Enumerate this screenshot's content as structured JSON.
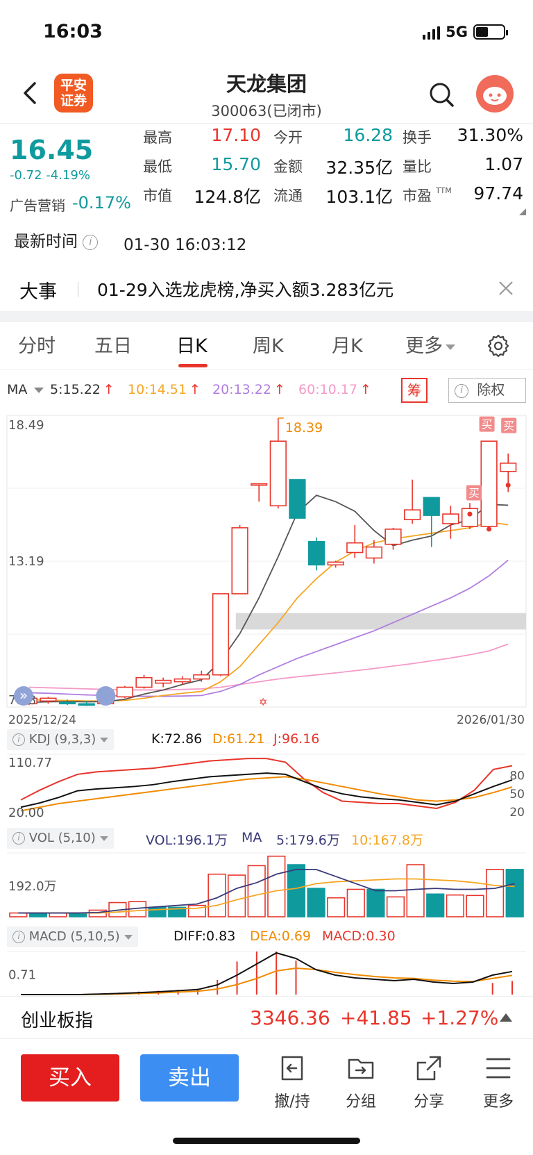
{
  "status": {
    "time": "16:03",
    "network": "5G"
  },
  "header": {
    "logo_text_1": "平安",
    "logo_text_2": "证券",
    "stock_name": "天龙集团",
    "stock_code": "300063(已闭市)"
  },
  "quote": {
    "price": "16.45",
    "change": "-0.72 -4.19%",
    "ad_label": "广告营销",
    "ad_value": "-0.17%",
    "high_label": "最高",
    "high_value": "17.10",
    "low_label": "最低",
    "low_value": "15.70",
    "mcap_label": "市值",
    "mcap_value": "124.8亿",
    "open_label": "今开",
    "open_value": "16.28",
    "amount_label": "金额",
    "amount_value": "32.35亿",
    "float_label": "流通",
    "float_value": "103.1亿",
    "turnover_label": "换手",
    "turnover_value": "31.30%",
    "volratio_label": "量比",
    "volratio_value": "1.07",
    "pe_label": "市盈",
    "pe_superscript": "TTM",
    "pe_value": "97.74"
  },
  "latest": {
    "label": "最新时间",
    "info_icon": "i",
    "value": "01-30 16:03:12"
  },
  "event": {
    "label": "大事",
    "text": "01-29入选龙虎榜,净买入额3.283亿元"
  },
  "tabs": [
    {
      "label": "分时"
    },
    {
      "label": "五日"
    },
    {
      "label": "日K"
    },
    {
      "label": "周K"
    },
    {
      "label": "月K"
    },
    {
      "label": "更多"
    }
  ],
  "ma_bar": {
    "label": "MA",
    "ma5": "5:15.22",
    "ma10": "10:14.51",
    "ma20": "20:13.22",
    "ma60": "60:10.17",
    "arrow": "↑",
    "chou": "筹",
    "chuquan": "除权"
  },
  "colors": {
    "up": "#e8352b",
    "down": "#0f9a9e",
    "ma5": "#555555",
    "ma10": "#f5a623",
    "ma20": "#b07ee0",
    "ma60": "#f59ac8"
  },
  "chart_data": [
    {
      "type": "candlestick",
      "title": "",
      "y_labels": [
        "18.49",
        "13.19",
        "7.88"
      ],
      "ylim": [
        7.88,
        18.49
      ],
      "x_start": "2025/12/24",
      "x_end": "2026/01/30",
      "max_label": "18.39",
      "buy_markers": [
        "买",
        "买",
        "买"
      ],
      "candles": [
        {
          "o": 8.0,
          "h": 8.2,
          "l": 7.95,
          "c": 8.2
        },
        {
          "o": 8.1,
          "h": 8.25,
          "l": 8.0,
          "c": 8.2
        },
        {
          "o": 8.05,
          "h": 8.15,
          "l": 7.95,
          "c": 8.0
        },
        {
          "o": 8.0,
          "h": 8.1,
          "l": 7.92,
          "c": 7.95
        },
        {
          "o": 8.0,
          "h": 8.3,
          "l": 7.95,
          "c": 8.25
        },
        {
          "o": 8.25,
          "h": 8.65,
          "l": 8.2,
          "c": 8.6
        },
        {
          "o": 8.6,
          "h": 9.05,
          "l": 8.55,
          "c": 8.95
        },
        {
          "o": 8.75,
          "h": 8.95,
          "l": 8.6,
          "c": 8.85
        },
        {
          "o": 8.8,
          "h": 9.0,
          "l": 8.7,
          "c": 8.9
        },
        {
          "o": 8.9,
          "h": 9.2,
          "l": 8.8,
          "c": 9.05
        },
        {
          "o": 9.05,
          "h": 12.0,
          "l": 9.0,
          "c": 12.0
        },
        {
          "o": 12.0,
          "h": 14.5,
          "l": 12.0,
          "c": 14.4
        },
        {
          "o": 16.0,
          "h": 16.0,
          "l": 15.35,
          "c": 16.0
        },
        {
          "o": 15.2,
          "h": 18.39,
          "l": 15.1,
          "c": 17.55
        },
        {
          "o": 16.15,
          "h": 16.15,
          "l": 14.75,
          "c": 14.75
        },
        {
          "o": 13.9,
          "h": 14.05,
          "l": 12.85,
          "c": 13.05
        },
        {
          "o": 13.05,
          "h": 13.2,
          "l": 12.95,
          "c": 13.15
        },
        {
          "o": 13.5,
          "h": 14.5,
          "l": 13.3,
          "c": 13.85
        },
        {
          "o": 13.3,
          "h": 13.95,
          "l": 13.1,
          "c": 13.7
        },
        {
          "o": 13.8,
          "h": 14.4,
          "l": 13.6,
          "c": 14.35
        },
        {
          "o": 14.7,
          "h": 16.15,
          "l": 14.55,
          "c": 15.05
        },
        {
          "o": 15.5,
          "h": 15.5,
          "l": 13.7,
          "c": 14.85
        },
        {
          "o": 14.55,
          "h": 15.2,
          "l": 14.0,
          "c": 14.9
        },
        {
          "o": 14.45,
          "h": 15.3,
          "l": 14.35,
          "c": 15.1
        },
        {
          "o": 14.45,
          "h": 17.55,
          "l": 14.45,
          "c": 17.55
        },
        {
          "o": 16.45,
          "h": 17.1,
          "l": 15.7,
          "c": 16.75
        }
      ],
      "ma5": [
        8.05,
        8.07,
        8.08,
        8.07,
        8.08,
        8.16,
        8.35,
        8.5,
        8.7,
        8.87,
        9.55,
        10.55,
        11.85,
        13.35,
        14.95,
        15.58,
        15.35,
        15.0,
        14.3,
        13.75,
        13.95,
        14.1,
        14.5,
        14.7,
        15.25,
        15.22
      ],
      "ma10": [
        8.15,
        8.13,
        8.12,
        8.1,
        8.1,
        8.12,
        8.2,
        8.3,
        8.38,
        8.45,
        8.8,
        9.35,
        10.15,
        10.95,
        11.85,
        12.55,
        13.15,
        13.55,
        13.85,
        14.0,
        14.1,
        14.2,
        14.3,
        14.4,
        14.6,
        14.51
      ],
      "ma20": [
        8.4,
        8.38,
        8.35,
        8.32,
        8.3,
        8.28,
        8.27,
        8.27,
        8.28,
        8.3,
        8.45,
        8.7,
        9.05,
        9.35,
        9.65,
        9.9,
        10.15,
        10.4,
        10.65,
        10.95,
        11.25,
        11.55,
        11.85,
        12.2,
        12.65,
        13.22
      ],
      "ma60": [
        8.6,
        8.58,
        8.56,
        8.54,
        8.52,
        8.5,
        8.5,
        8.5,
        8.52,
        8.54,
        8.6,
        8.7,
        8.8,
        8.9,
        8.98,
        9.05,
        9.12,
        9.2,
        9.28,
        9.37,
        9.46,
        9.56,
        9.66,
        9.78,
        9.92,
        10.17
      ]
    },
    {
      "type": "line",
      "name": "KDJ (9,3,3)",
      "k_label": "K:72.86",
      "d_label": "D:61.21",
      "j_label": "J:96.16",
      "y_labels": [
        "110.77",
        "20.00"
      ],
      "right_labels": [
        "80",
        "50",
        "20"
      ],
      "ylim": [
        10,
        115
      ],
      "K": [
        28,
        35,
        44,
        55,
        58,
        60,
        62,
        65,
        70,
        74,
        78,
        80,
        82,
        84,
        82,
        70,
        58,
        50,
        45,
        42,
        40,
        36,
        32,
        38,
        50,
        62,
        72.86
      ],
      "D": [
        22,
        28,
        34,
        38,
        42,
        46,
        50,
        54,
        58,
        62,
        66,
        70,
        74,
        76,
        78,
        74,
        68,
        62,
        56,
        50,
        45,
        40,
        38,
        40,
        44,
        52,
        61.21
      ],
      "J": [
        40,
        56,
        70,
        82,
        86,
        88,
        90,
        92,
        96,
        100,
        104,
        106,
        108,
        108,
        102,
        74,
        52,
        38,
        36,
        34,
        34,
        30,
        26,
        36,
        56,
        90,
        96.16
      ]
    },
    {
      "type": "bar",
      "name": "VOL (5,10)",
      "vol_label": "VOL:196.1万",
      "ma_label": "MA",
      "ma5_label": "5:179.6万",
      "ma10_label": "10:167.8万",
      "y_label": "192.0万",
      "volumes": [
        8,
        8,
        8,
        8,
        14,
        30,
        32,
        20,
        20,
        24,
        90,
        88,
        108,
        128,
        110,
        60,
        40,
        58,
        58,
        42,
        110,
        48,
        46,
        45,
        100,
        100
      ],
      "up": [
        true,
        false,
        true,
        false,
        true,
        true,
        true,
        false,
        false,
        true,
        true,
        true,
        true,
        true,
        false,
        false,
        true,
        true,
        false,
        true,
        true,
        false,
        true,
        true,
        true,
        false
      ],
      "ma5": [
        8,
        8,
        8,
        8,
        9,
        14,
        18,
        21,
        24,
        27,
        40,
        60,
        72,
        90,
        100,
        100,
        85,
        70,
        55,
        55,
        58,
        60,
        58,
        58,
        60,
        70
      ],
      "ma10": [
        8,
        8,
        8,
        8,
        8,
        10,
        13,
        15,
        17,
        18,
        24,
        36,
        46,
        55,
        60,
        70,
        74,
        76,
        78,
        80,
        80,
        78,
        76,
        72,
        66,
        64
      ]
    },
    {
      "type": "line",
      "name": "MACD (5,10,5)",
      "diff_label": "DIFF:0.83",
      "dea_label": "DEA:0.69",
      "macd_label": "MACD:0.30",
      "y_label": "0.71",
      "diff": [
        0.0,
        0.0,
        0.0,
        0.0,
        0.02,
        0.04,
        0.07,
        0.1,
        0.14,
        0.18,
        0.35,
        0.7,
        1.1,
        1.5,
        1.3,
        0.9,
        0.7,
        0.6,
        0.55,
        0.5,
        0.55,
        0.45,
        0.4,
        0.45,
        0.7,
        0.83
      ],
      "dea": [
        0.0,
        0.0,
        0.0,
        0.0,
        0.01,
        0.02,
        0.04,
        0.06,
        0.09,
        0.12,
        0.2,
        0.36,
        0.58,
        0.85,
        0.95,
        0.9,
        0.8,
        0.72,
        0.65,
        0.6,
        0.58,
        0.52,
        0.48,
        0.47,
        0.58,
        0.69
      ]
    }
  ],
  "kdj_bar": {
    "label": "KDJ (9,3,3)"
  },
  "vol_bar": {
    "label": "VOL (5,10)"
  },
  "macd_bar": {
    "label": "MACD (5,10,5)"
  },
  "index": {
    "name": "创业板指",
    "value": "3346.36",
    "change": "+41.85",
    "pct": "+1.27%"
  },
  "bottom": {
    "buy": "买入",
    "sell": "卖出",
    "actions": [
      {
        "label": "撤/持"
      },
      {
        "label": "分组"
      },
      {
        "label": "分享"
      },
      {
        "label": "更多"
      }
    ]
  }
}
